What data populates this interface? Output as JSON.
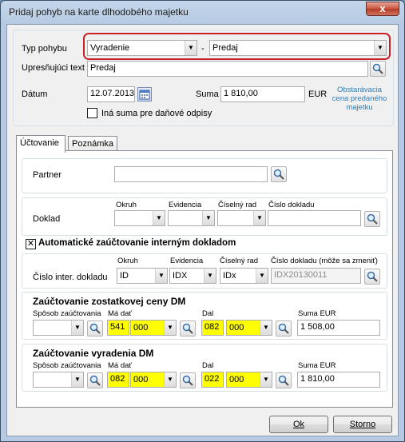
{
  "window": {
    "title": "Pridaj pohyb na karte dlhodobého majetku",
    "close": "x"
  },
  "movement": {
    "type_label": "Typ pohybu",
    "type_value": "Vyradenie",
    "separator": "-",
    "subtype_value": "Predaj",
    "spec_label": "Upresňujúci text",
    "spec_value": "Predaj",
    "date_label": "Dátum",
    "date_value": "12.07.2013",
    "sum_label": "Suma",
    "sum_value": "1 810,00",
    "currency": "EUR",
    "link_line1": "Obstarávacia",
    "link_line2": "cena predaného",
    "link_line3": "majetku",
    "tax_checkbox_label": "Iná suma pre daňové odpisy",
    "tax_checked": false
  },
  "tabs": [
    {
      "label": "Účtovanie",
      "active": true
    },
    {
      "label": "Poznámka",
      "active": false
    }
  ],
  "accounting": {
    "partner_label": "Partner",
    "partner_value": "",
    "doc_label": "Doklad",
    "col_okruh": "Okruh",
    "col_evidencia": "Evidencia",
    "col_ciselny_rad": "Číselný rad",
    "col_cislo_dokladu": "Číslo dokladu",
    "auto_checkbox_label": "Automatické zaúčtovanie interným dokladom",
    "auto_checked": true,
    "inter_doc_label": "Číslo inter. dokladu",
    "inter_cislo_label": "Číslo dokladu (môže sa zmeniť)",
    "inter_okruh": "ID",
    "inter_evidencia": "IDX",
    "inter_rad": "IDx",
    "inter_cislo": "IDX20130011",
    "residual_title": "Zaúčtovanie zostatkovej ceny DM",
    "disposal_title": "Zaúčtovanie vyradenia DM",
    "col_sposob": "Spôsob zaúčtovania",
    "col_ma_dat": "Má dať",
    "col_dal": "Dal",
    "col_suma": "Suma EUR",
    "residual": {
      "md_synt": "541",
      "md_anal": "000",
      "d_synt": "082",
      "d_anal": "000",
      "sum": "1 508,00"
    },
    "disposal": {
      "md_synt": "082",
      "md_anal": "000",
      "d_synt": "022",
      "d_anal": "000",
      "sum": "1 810,00"
    }
  },
  "buttons": {
    "ok": "Ok",
    "storno": "Storno"
  },
  "colors": {
    "highlight": "#c7222a",
    "accounts": "#ffff00",
    "link": "#2f7fb8"
  }
}
